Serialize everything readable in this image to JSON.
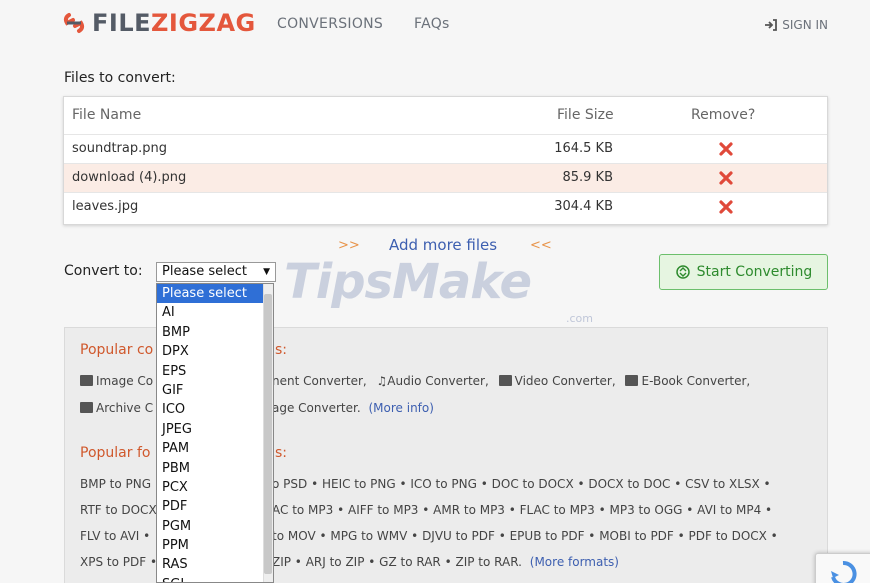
{
  "header": {
    "logo_a": "FILE",
    "logo_b": "ZIGZAG",
    "nav": [
      {
        "label": "CONVERSIONS"
      },
      {
        "label": "FAQs"
      }
    ],
    "signin": "SIGN IN"
  },
  "files": {
    "label": "Files to convert:",
    "columns": [
      "File Name",
      "File Size",
      "Remove?"
    ],
    "rows": [
      {
        "name": "soundtrap.png",
        "size": "164.5 KB"
      },
      {
        "name": "download (4).png",
        "size": "85.9 KB"
      },
      {
        "name": "leaves.jpg",
        "size": "304.4 KB"
      }
    ],
    "add_more": "Add more files",
    "chev_left": ">>",
    "chev_right": "<<"
  },
  "convert": {
    "label": "Convert to:",
    "selected": "Please select",
    "options": [
      "Please select",
      "AI",
      "BMP",
      "DPX",
      "EPS",
      "GIF",
      "ICO",
      "JPEG",
      "PAM",
      "PBM",
      "PCX",
      "PDF",
      "PGM",
      "PPM",
      "RAS",
      "SGI"
    ],
    "start_button": "Start Converting"
  },
  "watermark": {
    "text": "TipsMake",
    "sub": ".com"
  },
  "popular": {
    "conv_heading_left": "Popular co",
    "conv_heading_right": "s:",
    "conv_line1_a": "Image Co",
    "conv_line1_b": "nent Converter,",
    "conv_line1_c": "Audio Converter,",
    "conv_line1_d": "Video Converter,",
    "conv_line1_e": "E-Book Converter,",
    "conv_line2_a": "Archive C",
    "conv_line2_b": "age Converter.",
    "conv_line2_link": "(More info)",
    "fmt_heading_left": "Popular fo",
    "fmt_heading_right": "s:",
    "fmt_lines_left": [
      "BMP to PNG",
      "RTF to DOCX",
      "FLV to AVI •",
      "XPS to PDF •"
    ],
    "fmt_lines_right": [
      "o PSD • HEIC to PNG • ICO to PNG • DOC to DOCX • DOCX to DOC • CSV to XLSX •",
      "AC to MP3 • AIFF to MP3 • AMR to MP3 • FLAC to MP3 • MP3 to OGG • AVI to MP4 •",
      "to MOV • MPG to WMV • DJVU to PDF • EPUB to PDF • MOBI to PDF • PDF to DOCX •",
      "ZIP • ARJ to ZIP • GZ to RAR • ZIP to RAR."
    ],
    "fmt_more_link": "(More formats)"
  },
  "colors": {
    "accent": "#e4573c",
    "link": "#3d5fb0",
    "start_green": "#2e8b2e",
    "row_alt": "#fbece5",
    "remove_red": "#e0493a"
  }
}
